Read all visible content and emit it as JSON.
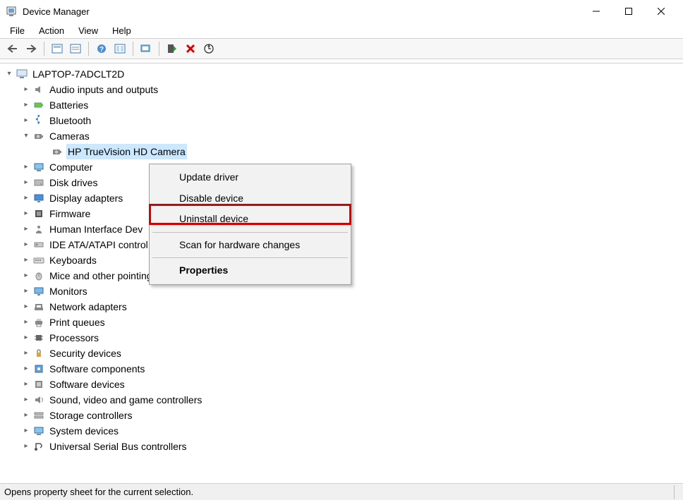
{
  "window": {
    "title": "Device Manager"
  },
  "menu": {
    "file": "File",
    "action": "Action",
    "view": "View",
    "help": "Help"
  },
  "tree": {
    "root": {
      "label": "LAPTOP-7ADCLT2D"
    },
    "items": [
      {
        "label": "Audio inputs and outputs",
        "expanded": false
      },
      {
        "label": "Batteries",
        "expanded": false
      },
      {
        "label": "Bluetooth",
        "expanded": false
      },
      {
        "label": "Cameras",
        "expanded": true,
        "children": [
          {
            "label": "HP TrueVision HD Camera",
            "selected": true
          }
        ]
      },
      {
        "label": "Computer",
        "expanded": false
      },
      {
        "label": "Disk drives",
        "expanded": false
      },
      {
        "label": "Display adapters",
        "expanded": false
      },
      {
        "label": "Firmware",
        "expanded": false
      },
      {
        "label": "Human Interface Devices",
        "expanded": false,
        "truncated": "Human Interface Dev"
      },
      {
        "label": "IDE ATA/ATAPI controllers",
        "expanded": false,
        "truncated": "IDE ATA/ATAPI control"
      },
      {
        "label": "Keyboards",
        "expanded": false
      },
      {
        "label": "Mice and other pointing devices",
        "expanded": false
      },
      {
        "label": "Monitors",
        "expanded": false
      },
      {
        "label": "Network adapters",
        "expanded": false
      },
      {
        "label": "Print queues",
        "expanded": false
      },
      {
        "label": "Processors",
        "expanded": false
      },
      {
        "label": "Security devices",
        "expanded": false
      },
      {
        "label": "Software components",
        "expanded": false
      },
      {
        "label": "Software devices",
        "expanded": false
      },
      {
        "label": "Sound, video and game controllers",
        "expanded": false
      },
      {
        "label": "Storage controllers",
        "expanded": false
      },
      {
        "label": "System devices",
        "expanded": false
      },
      {
        "label": "Universal Serial Bus controllers",
        "expanded": false
      }
    ]
  },
  "context_menu": {
    "update": "Update driver",
    "disable": "Disable device",
    "uninstall": "Uninstall device",
    "scan": "Scan for hardware changes",
    "properties": "Properties"
  },
  "status": {
    "text": "Opens property sheet for the current selection."
  }
}
